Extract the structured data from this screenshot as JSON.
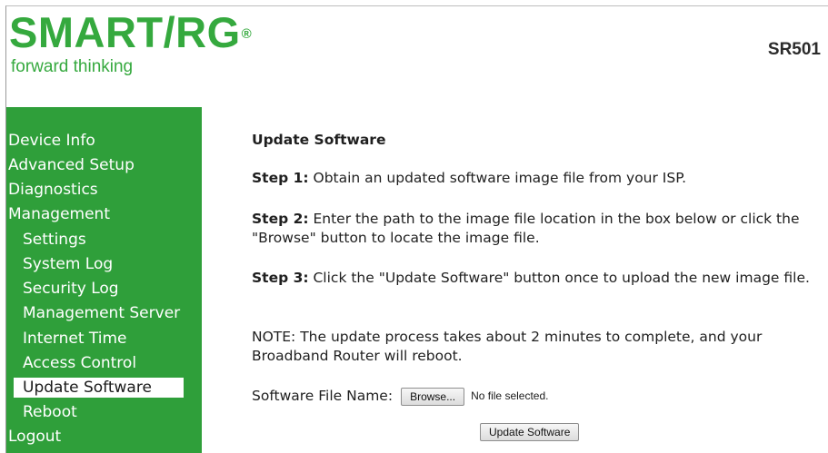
{
  "brand": {
    "logo_text": "SMART/RG",
    "registered": "®",
    "tagline": "forward thinking",
    "model": "SR501"
  },
  "colors": {
    "brand_green": "#35a93e",
    "sidebar_bg": "#2f9f3a"
  },
  "sidebar": {
    "items": [
      {
        "label": "Device Info"
      },
      {
        "label": "Advanced Setup"
      },
      {
        "label": "Diagnostics"
      },
      {
        "label": "Management"
      },
      {
        "label": "Settings"
      },
      {
        "label": "System Log"
      },
      {
        "label": "Security Log"
      },
      {
        "label": "Management Server"
      },
      {
        "label": "Internet Time"
      },
      {
        "label": "Access Control"
      },
      {
        "label": "Update Software",
        "active": true
      },
      {
        "label": "Reboot"
      },
      {
        "label": "Logout"
      }
    ]
  },
  "main": {
    "title": "Update Software",
    "step1": {
      "label": "Step 1:",
      "text": " Obtain an updated software image file from your ISP."
    },
    "step2": {
      "label": "Step 2:",
      "text": " Enter the path to the image file location in the box below or click the \"Browse\" button to locate the image file."
    },
    "step3": {
      "label": "Step 3:",
      "text": " Click the \"Update Software\" button once to upload the new image file."
    },
    "note": "NOTE: The update process takes about 2 minutes to complete, and your Broadband Router will reboot.",
    "file_label": "Software File Name:",
    "browse_label": "Browse...",
    "file_status": "No file selected.",
    "update_button": "Update Software"
  }
}
